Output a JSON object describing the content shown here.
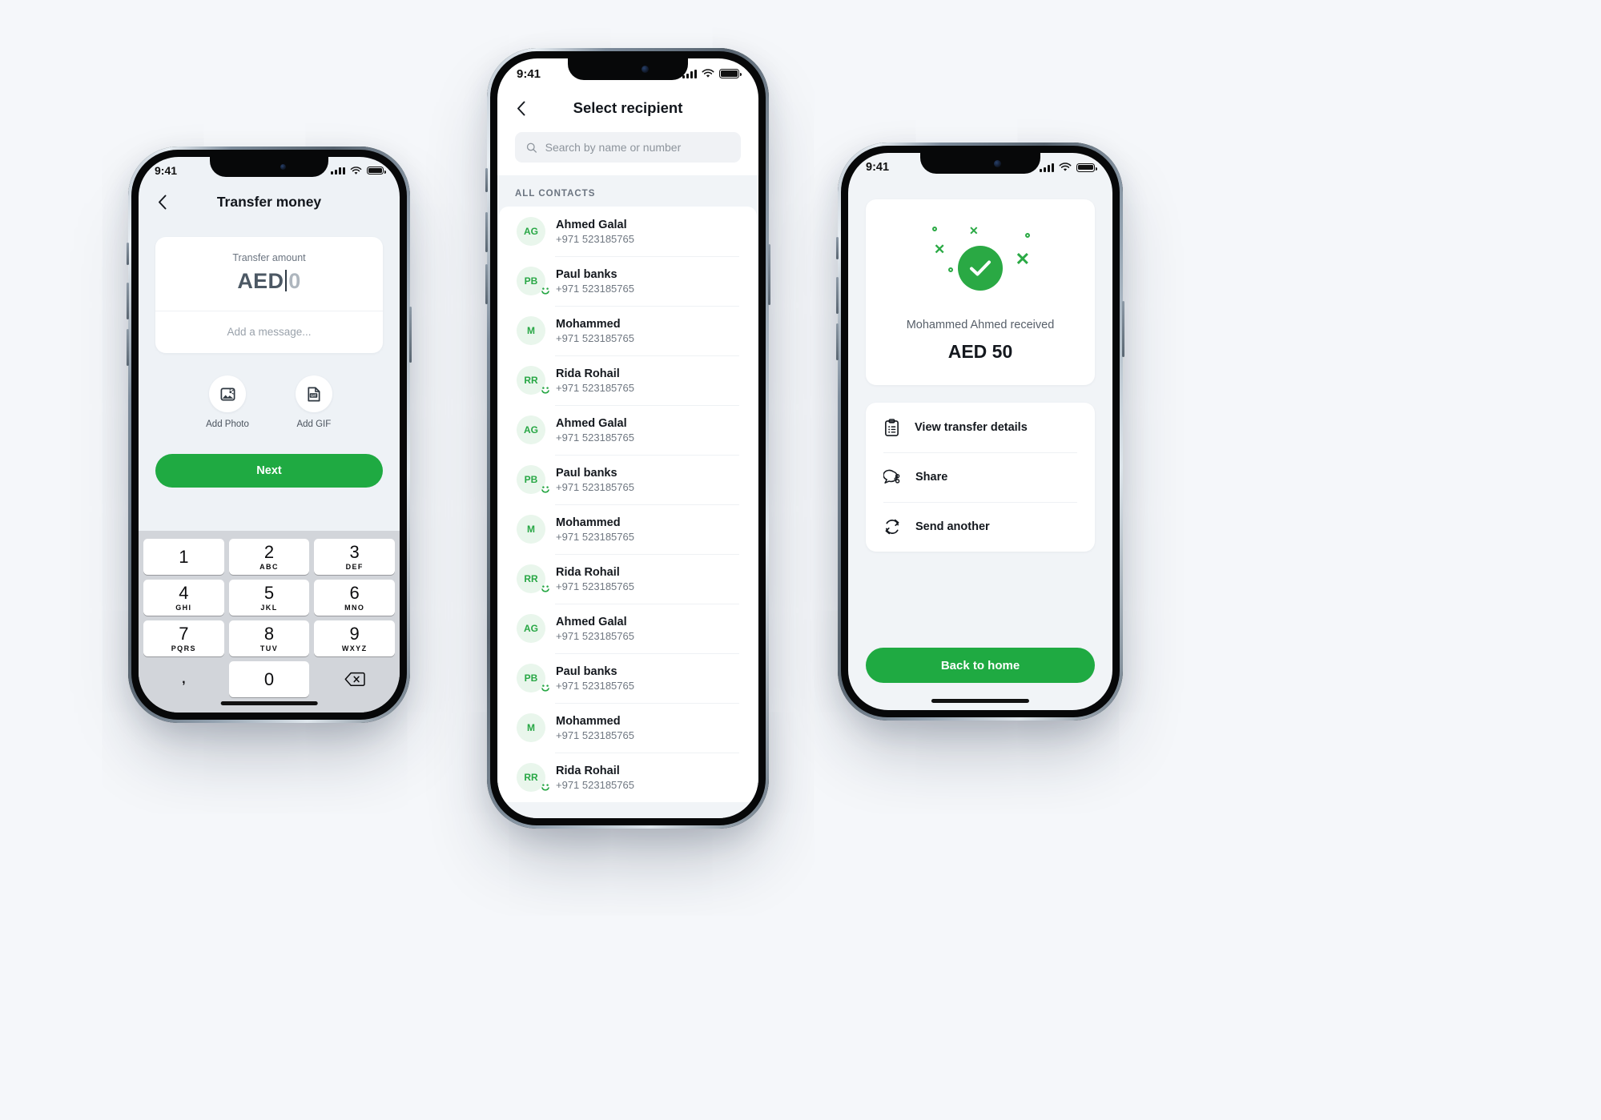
{
  "phone1": {
    "status": {
      "time": "9:41",
      "signal_icon": "cellular-bars-icon",
      "wifi_icon": "wifi-icon",
      "battery_icon": "battery-full-icon"
    },
    "nav": {
      "back_icon": "chevron-left-icon",
      "title": "Transfer money"
    },
    "amount": {
      "label": "Transfer amount",
      "currency": "AED",
      "value": "0",
      "message_placeholder": "Add a message..."
    },
    "attachments": [
      {
        "icon": "photo-icon",
        "label": "Add Photo"
      },
      {
        "icon": "gif-icon",
        "label": "Add GIF"
      }
    ],
    "next_label": "Next",
    "keypad": {
      "rows": [
        [
          {
            "num": "1",
            "sub": ""
          },
          {
            "num": "2",
            "sub": "ABC"
          },
          {
            "num": "3",
            "sub": "DEF"
          }
        ],
        [
          {
            "num": "4",
            "sub": "GHI"
          },
          {
            "num": "5",
            "sub": "JKL"
          },
          {
            "num": "6",
            "sub": "MNO"
          }
        ],
        [
          {
            "num": "7",
            "sub": "PQRS"
          },
          {
            "num": "8",
            "sub": "TUV"
          },
          {
            "num": "9",
            "sub": "WXYZ"
          }
        ]
      ],
      "comma": ",",
      "zero": "0",
      "delete_icon": "backspace-icon"
    }
  },
  "phone2": {
    "status": {
      "time": "9:41",
      "signal_icon": "cellular-bars-icon",
      "wifi_icon": "wifi-icon",
      "battery_icon": "battery-full-icon"
    },
    "nav": {
      "back_icon": "chevron-left-icon",
      "title": "Select recipient"
    },
    "search": {
      "icon": "search-icon",
      "placeholder": "Search by name or number",
      "value": ""
    },
    "section_label": "ALL CONTACTS",
    "contacts": [
      {
        "initials": "AG",
        "name": "Ahmed Galal",
        "phone": "+971 523185765",
        "badge": false
      },
      {
        "initials": "PB",
        "name": "Paul banks",
        "phone": "+971 523185765",
        "badge": true
      },
      {
        "initials": "M",
        "name": "Mohammed",
        "phone": "+971 523185765",
        "badge": false
      },
      {
        "initials": "RR",
        "name": "Rida Rohail",
        "phone": "+971 523185765",
        "badge": true
      },
      {
        "initials": "AG",
        "name": "Ahmed Galal",
        "phone": "+971 523185765",
        "badge": false
      },
      {
        "initials": "PB",
        "name": "Paul banks",
        "phone": "+971 523185765",
        "badge": true
      },
      {
        "initials": "M",
        "name": "Mohammed",
        "phone": "+971 523185765",
        "badge": false
      },
      {
        "initials": "RR",
        "name": "Rida Rohail",
        "phone": "+971 523185765",
        "badge": true
      },
      {
        "initials": "AG",
        "name": "Ahmed Galal",
        "phone": "+971 523185765",
        "badge": false
      },
      {
        "initials": "PB",
        "name": "Paul banks",
        "phone": "+971 523185765",
        "badge": true
      },
      {
        "initials": "M",
        "name": "Mohammed",
        "phone": "+971 523185765",
        "badge": false
      },
      {
        "initials": "RR",
        "name": "Rida Rohail",
        "phone": "+971 523185765",
        "badge": true
      }
    ]
  },
  "phone3": {
    "status": {
      "time": "9:41",
      "signal_icon": "cellular-bars-icon",
      "wifi_icon": "wifi-icon",
      "battery_icon": "battery-full-icon"
    },
    "success": {
      "icon": "check-circle-icon",
      "received_line": "Mohammed Ahmed received",
      "amount": "AED 50"
    },
    "actions": [
      {
        "icon": "clipboard-list-icon",
        "label": "View transfer details"
      },
      {
        "icon": "share-chat-icon",
        "label": "Share"
      },
      {
        "icon": "refresh-icon",
        "label": "Send another"
      }
    ],
    "back_home_label": "Back to home"
  },
  "colors": {
    "brand_green": "#1faa42",
    "success_green": "#2aa944",
    "avatar_green": "#28a745",
    "page_bg": "#f5f7fa"
  }
}
